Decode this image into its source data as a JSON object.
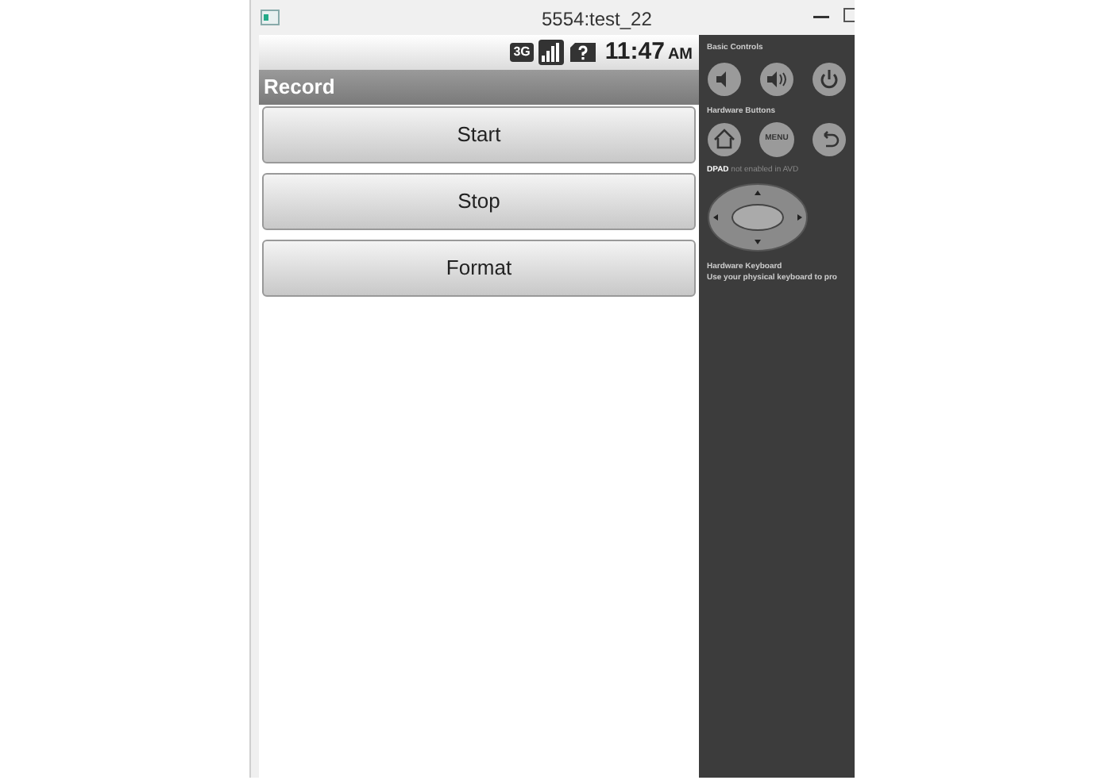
{
  "window": {
    "title": "5554:test_22"
  },
  "status_bar": {
    "network": "3G",
    "time": "11:47",
    "ampm": "AM"
  },
  "app": {
    "title": "Record",
    "buttons": [
      "Start",
      "Stop",
      "Format"
    ]
  },
  "controls": {
    "basic_label": "Basic Controls",
    "hardware_label": "Hardware Buttons",
    "menu_key": "MENU",
    "dpad_note": "**DPAD** not enabled in AVD",
    "keyboard_label": "Hardware Keyboard",
    "keyboard_note": "Use your physical keyboard to pro"
  }
}
